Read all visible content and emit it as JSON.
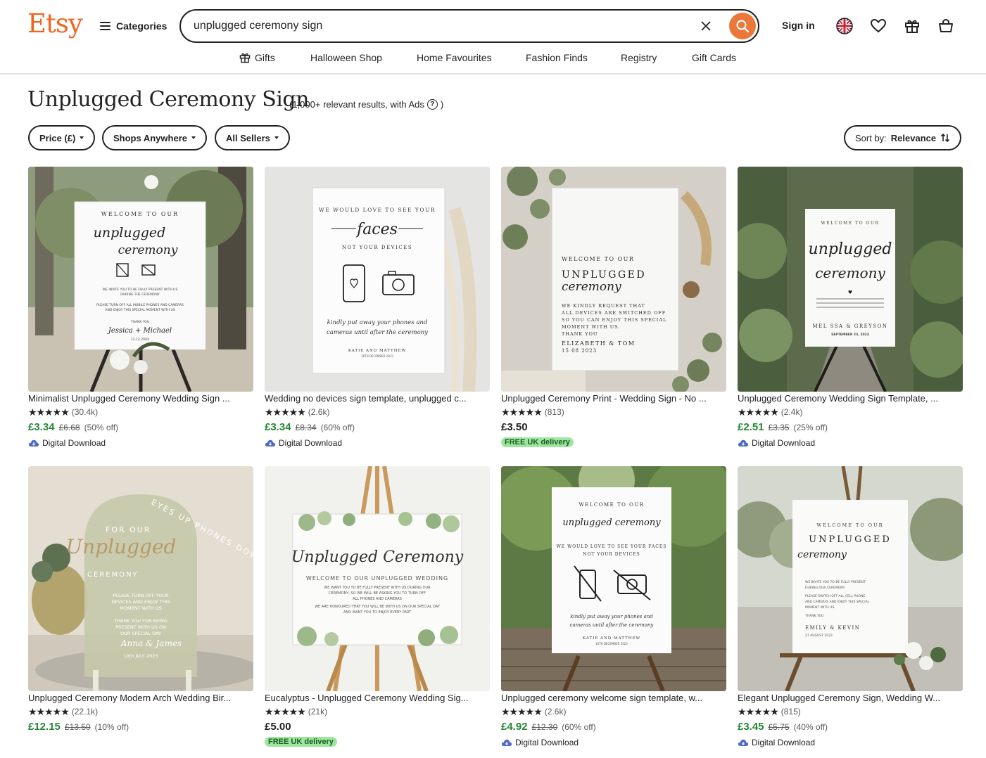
{
  "header": {
    "logo": "Etsy",
    "categories_label": "Categories",
    "search_value": "unplugged ceremony sign",
    "signin_label": "Sign in"
  },
  "nav": [
    {
      "label": "Gifts",
      "icon": "gift-icon"
    },
    {
      "label": "Halloween Shop"
    },
    {
      "label": "Home Favourites"
    },
    {
      "label": "Fashion Finds"
    },
    {
      "label": "Registry"
    },
    {
      "label": "Gift Cards"
    }
  ],
  "page": {
    "title": "Unplugged Ceremony Sign",
    "result_count": "(1,000+ relevant results, with Ads",
    "result_count_close": ")"
  },
  "filters": {
    "price": "Price (£)",
    "shops": "Shops Anywhere",
    "sellers": "All Sellers",
    "sort_label": "Sort by:",
    "sort_value": "Relevance"
  },
  "colors": {
    "brand": "#F1641E",
    "search_button": "#E9783A",
    "sale_price": "#258635",
    "free_delivery_bg": "#9EE59F"
  },
  "products": [
    {
      "title": "Minimalist Unplugged Ceremony Wedding Sign ...",
      "stars": "★★★★★",
      "reviews": "(30.4k)",
      "price": "£3.34",
      "old_price": "£6.68",
      "discount": "(50% off)",
      "badge": "Digital Download"
    },
    {
      "title": "Wedding no devices sign template, unplugged c...",
      "stars": "★★★★★",
      "reviews": "(2.6k)",
      "price": "£3.34",
      "old_price": "£8.34",
      "discount": "(60% off)",
      "badge": "Digital Download"
    },
    {
      "title": "Unplugged Ceremony Print - Wedding Sign - No ...",
      "stars": "★★★★★",
      "reviews": "(813)",
      "price": "£3.50",
      "old_price": "",
      "discount": "",
      "badge": "FREE UK delivery"
    },
    {
      "title": "Unplugged Ceremony Wedding Sign Template, ...",
      "stars": "★★★★★",
      "reviews": "(2.4k)",
      "price": "£2.51",
      "old_price": "£3.35",
      "discount": "(25% off)",
      "badge": "Digital Download"
    },
    {
      "title": "Unplugged Ceremony Modern Arch Wedding Bir...",
      "stars": "★★★★★",
      "reviews": "(22.1k)",
      "price": "£12.15",
      "old_price": "£13.50",
      "discount": "(10% off)",
      "badge": ""
    },
    {
      "title": "Eucalyptus - Unplugged Ceremony Wedding Sig...",
      "stars": "★★★★★",
      "reviews": "(21k)",
      "price": "£5.00",
      "old_price": "",
      "discount": "",
      "badge": "FREE UK delivery"
    },
    {
      "title": "Unplugged ceremony welcome sign template, w...",
      "stars": "★★★★★",
      "reviews": "(2.6k)",
      "price": "£4.92",
      "old_price": "£12.30",
      "discount": "(60% off)",
      "badge": "Digital Download"
    },
    {
      "title": "Elegant Unplugged Ceremony Sign, Wedding W...",
      "stars": "★★★★★",
      "reviews": "(815)",
      "price": "£3.45",
      "old_price": "£5.75",
      "discount": "(40% off)",
      "badge": "Digital Download"
    }
  ],
  "signs": {
    "s1": {
      "l1": "WELCOME TO OUR",
      "l2": "unplugged",
      "l3": "ceremony",
      "l4": "WE INVITE YOU TO BE FULLY PRESENT WITH US",
      "l5": "DURING THE CEREMONY",
      "l6": "PLEASE TURN OFF ALL MOBILE PHONES AND CAMERAS",
      "l7": "AND ENJOY THIS SPECIAL MOMENT WITH US",
      "l8": "THANK YOU",
      "l9": "Jessica + Michael",
      "l10": "12.12.20XX"
    },
    "s2": {
      "l1": "WE WOULD LOVE TO SEE YOUR",
      "l2": "faces",
      "l3": "NOT YOUR DEVICES",
      "l4": "kindly put away your phones and",
      "l5": "cameras until after the ceremony",
      "l6": "KATIE AND MATTHEW",
      "l7": "16TH DECEMBER 2023"
    },
    "s3": {
      "l1": "WELCOME TO OUR",
      "l2": "UNPLUGGED",
      "l3": "ceremony",
      "l4": "WE KINDLY REQUEST THAT",
      "l5": "ALL DEVICES ARE SWITCHED OFF",
      "l6": "SO YOU CAN ENJOY THIS SPECIAL",
      "l7": "MOMENT WITH US.",
      "l8": "THANK YOU",
      "l9": "ELIZABETH & TOM",
      "l10": "15 08 2023"
    },
    "s4": {
      "l1": "WELCOME TO OUR",
      "l2": "unplugged",
      "l3": "ceremony",
      "l4": "MEL SSA & GREYSON",
      "l5": "SEPTEMBER 23, 2023"
    },
    "s5": {
      "l1": "FOR OUR",
      "l2": "Unplugged",
      "l3": "CEREMONY",
      "l4": "EYES UP PHONES DOWN",
      "l5": "PLEASE TURN OFF YOUR",
      "l6": "DEVICES AND ENJOY THIS",
      "l7": "MOMENT WITH US",
      "l8": "THANK YOU FOR BEING",
      "l9": "PRESENT WITH US ON",
      "l10": "OUR SPECIAL DAY",
      "l11": "Anna & James",
      "l12": "10th JULY 2023"
    },
    "s6": {
      "l1": "Unplugged Ceremony",
      "l2": "WELCOME TO OUR UNPLUGGED WEDDING",
      "l3": "WE WANT YOU TO BE FULLY PRESENT WITH US DURING OUR",
      "l4": "CEREMONY, SO WE WILL BE ASKING YOU TO TURN OFF",
      "l5": "ALL PHONES AND CAMERAS",
      "l6": "WE ARE HONOURED THAT YOU WILL BE WITH US ON OUR SPECIAL DAY",
      "l7": "AND WANT YOU TO ENJOY EVERY PART"
    },
    "s7": {
      "l1": "WELCOME TO OUR",
      "l2": "unplugged ceremony",
      "l3": "WE WOULD LOVE TO SEE YOUR FACES",
      "l4": "NOT YOUR DEVICES",
      "l5": "kindly put away your phones and",
      "l6": "cameras until after the ceremony",
      "l7": "KATIE AND MATTHEW",
      "l8": "16TH DECEMBER 2023"
    },
    "s8": {
      "l1": "WELCOME TO OUR",
      "l2": "UNPLUGGED",
      "l3": "ceremony",
      "l4": "WE INVITE YOU TO BE FULLY PRESENT",
      "l5": "DURING OUR CEREMONY.",
      "l6": "PLEASE SWITCH OFF ALL CELL PHONE",
      "l7": "AND CAMERAS AND ENJOY THIS SPECIAL",
      "l8": "MOMENT WITH US.",
      "l9": "THANK YOU",
      "l10": "EMILY & KEVIN",
      "l11": "27 AUGUST 2023"
    }
  }
}
